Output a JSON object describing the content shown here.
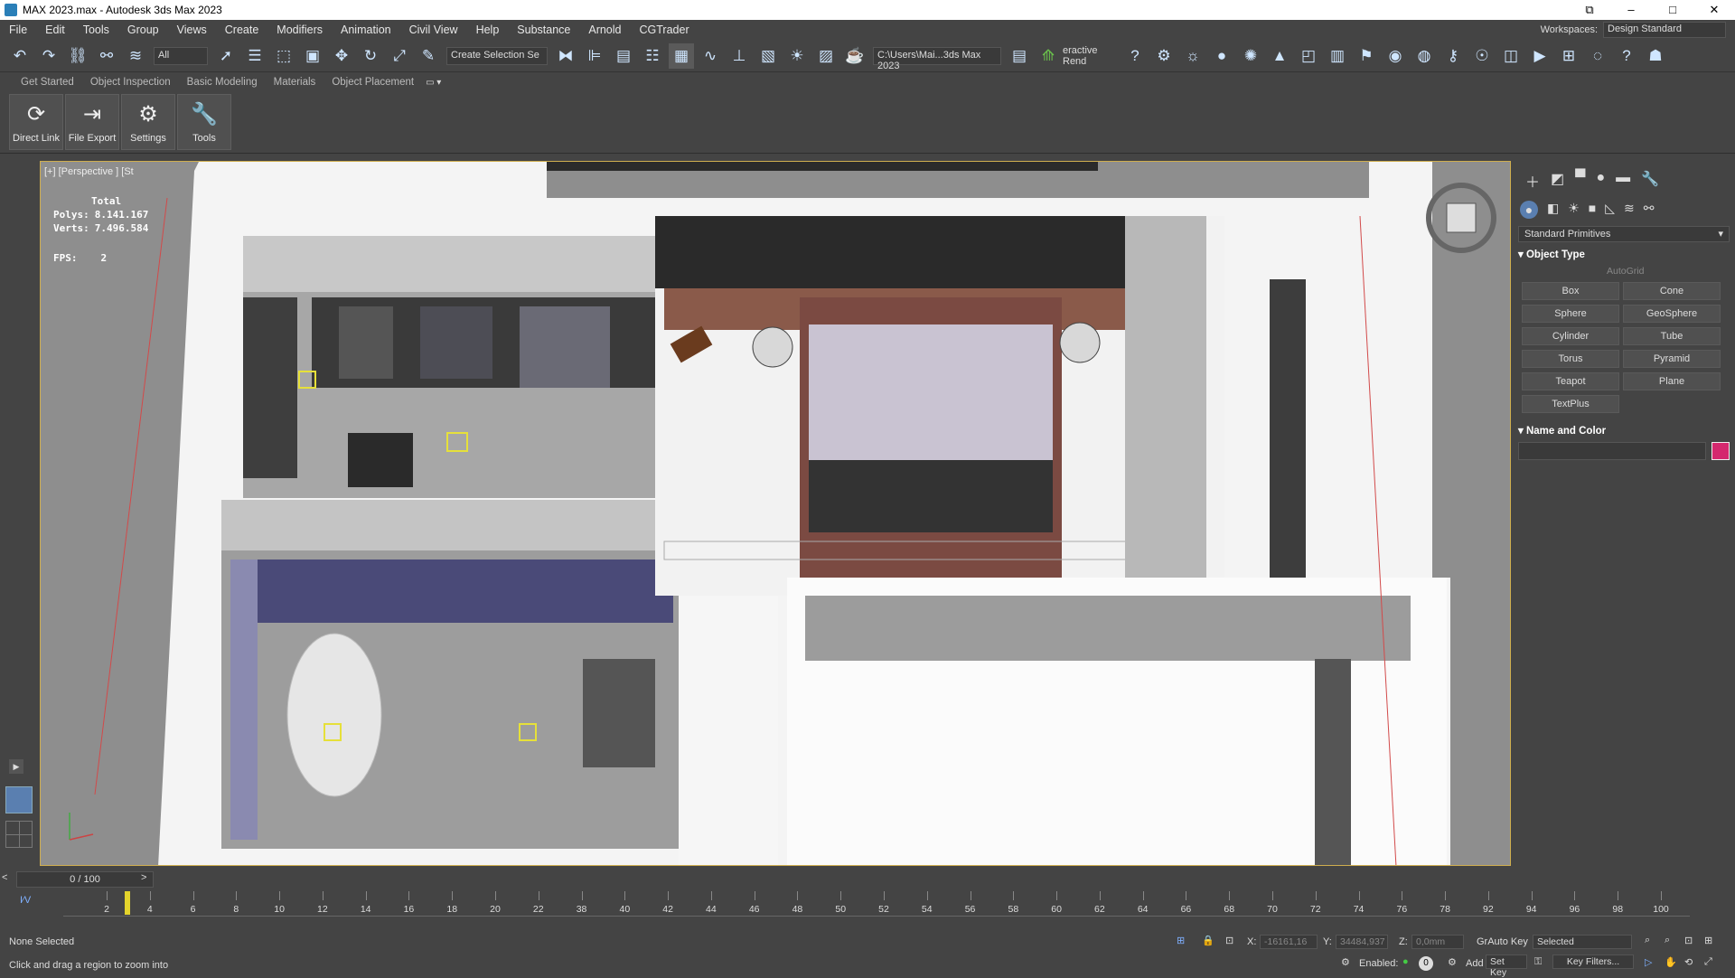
{
  "window": {
    "title": "MAX 2023.max - Autodesk 3ds Max 2023"
  },
  "menu": [
    "File",
    "Edit",
    "Tools",
    "Group",
    "Views",
    "Create",
    "Modifiers",
    "Animation",
    "Civil View",
    "Help",
    "Substance",
    "Arnold",
    "CGTrader"
  ],
  "workspace": {
    "label": "Workspaces:",
    "value": "Design Standard"
  },
  "toolbar": {
    "filter": "All",
    "selection_set": "Create Selection Se",
    "path": "C:\\Users\\Mai...3ds Max 2023",
    "render_label": "eractive Rend"
  },
  "ribbon_tabs": [
    "Get Started",
    "Object Inspection",
    "Basic Modeling",
    "Materials",
    "Object Placement"
  ],
  "ribbon_buttons": [
    {
      "label": "Direct Link",
      "icon": "sync-icon"
    },
    {
      "label": "File Export",
      "icon": "export-icon"
    },
    {
      "label": "Settings",
      "icon": "gear-icon"
    },
    {
      "label": "Tools",
      "icon": "wrench-icon"
    }
  ],
  "viewport": {
    "label": "[+] [Perspective ] [St",
    "stats": {
      "total_label": "Total",
      "polys_label": "Polys:",
      "polys": "8.141.167",
      "verts_label": "Verts:",
      "verts": "7.496.584",
      "fps_label": "FPS:",
      "fps": "2"
    }
  },
  "command_panel": {
    "category": "Standard Primitives",
    "object_type_title": "Object Type",
    "autogrid": "AutoGrid",
    "primitives": [
      "Box",
      "Cone",
      "Sphere",
      "GeoSphere",
      "Cylinder",
      "Tube",
      "Torus",
      "Pyramid",
      "Teapot",
      "Plane",
      "TextPlus"
    ],
    "name_color_title": "Name and Color",
    "color": "#d4286e"
  },
  "timeline": {
    "frame": "0 / 100",
    "ticks": [
      "2",
      "4",
      "6",
      "8",
      "10",
      "12",
      "14",
      "16",
      "18",
      "20",
      "22",
      "38",
      "40",
      "42",
      "44",
      "46",
      "48",
      "50",
      "52",
      "54",
      "56",
      "58",
      "60",
      "62",
      "64",
      "66",
      "68",
      "70",
      "72",
      "74",
      "76",
      "78",
      "92",
      "94",
      "96",
      "98",
      "100"
    ]
  },
  "status": {
    "selection": "None Selected",
    "hint": "Click and drag a region to zoom into",
    "x_label": "X:",
    "x": "-16161,16",
    "y_label": "Y:",
    "y": "34484,937",
    "z_label": "Z:",
    "z": "0,0mm",
    "autokey": "GrAuto Key",
    "autokey_mode": "Selected",
    "setkey": "Set Key",
    "keyfilters": "Key Filters...",
    "enabled": "Enabled:",
    "add": "Add",
    "frame_spinner": "0"
  }
}
